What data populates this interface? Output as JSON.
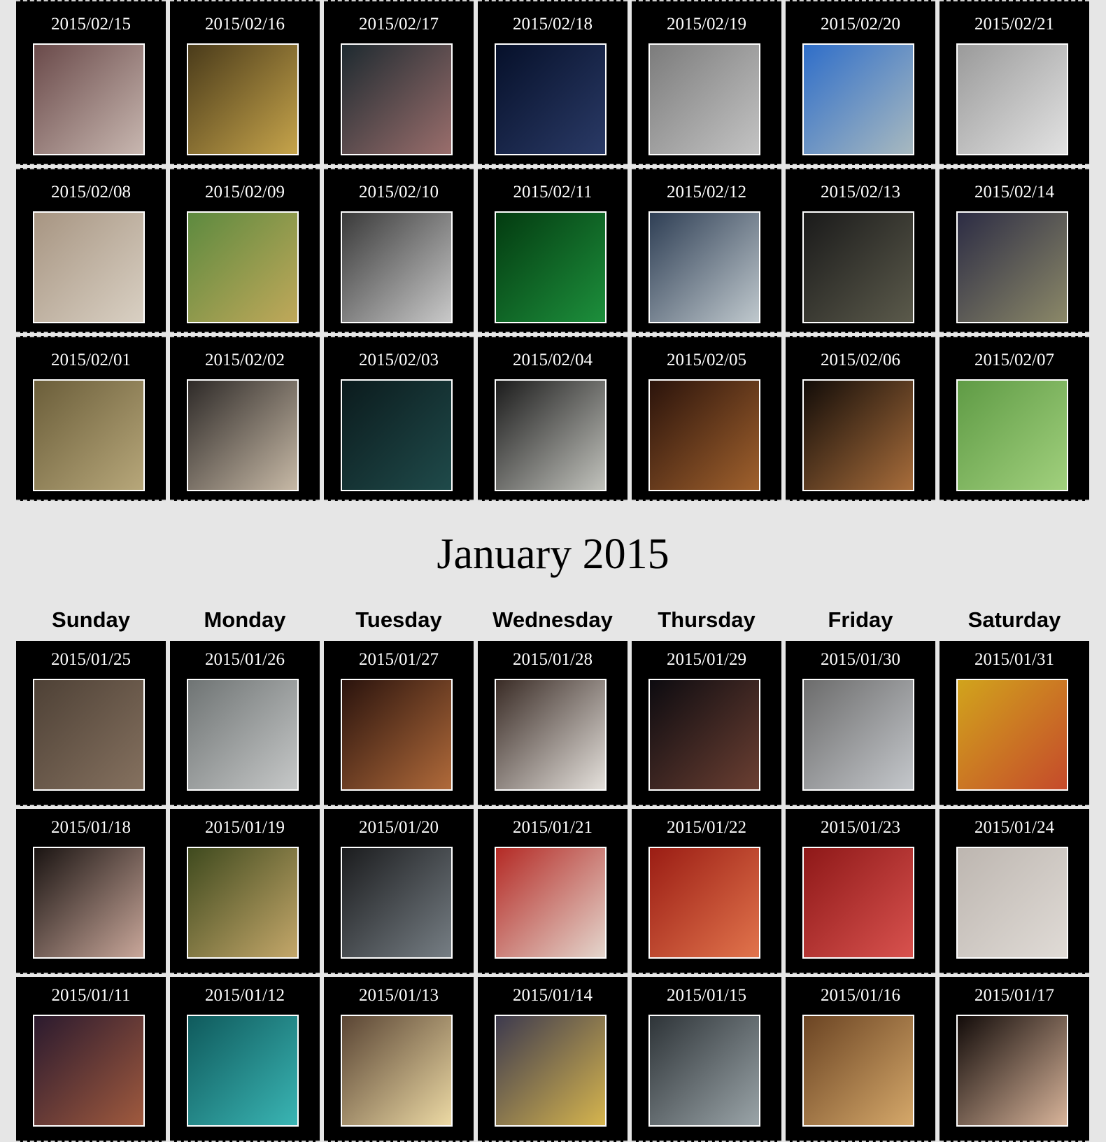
{
  "feb": {
    "weeks": [
      [
        {
          "date": "2015/02/15",
          "colors": [
            "#6a4a4a",
            "#c8b7b0"
          ]
        },
        {
          "date": "2015/02/16",
          "colors": [
            "#4a3b1a",
            "#c6a44b"
          ]
        },
        {
          "date": "2015/02/17",
          "colors": [
            "#1e2a30",
            "#9a6e6c"
          ]
        },
        {
          "date": "2015/02/18",
          "colors": [
            "#06102a",
            "#2a3a66"
          ]
        },
        {
          "date": "2015/02/19",
          "colors": [
            "#7c7c7c",
            "#c3c3c3"
          ]
        },
        {
          "date": "2015/02/20",
          "colors": [
            "#2f6ec9",
            "#a8b9bf"
          ]
        },
        {
          "date": "2015/02/21",
          "colors": [
            "#9a9a9a",
            "#e2e2e2"
          ]
        }
      ],
      [
        {
          "date": "2015/02/08",
          "colors": [
            "#a79582",
            "#d9d0c3"
          ]
        },
        {
          "date": "2015/02/09",
          "colors": [
            "#5d8a3f",
            "#c0a85a"
          ]
        },
        {
          "date": "2015/02/10",
          "colors": [
            "#3a3a3a",
            "#c9c9c9"
          ]
        },
        {
          "date": "2015/02/11",
          "colors": [
            "#033b10",
            "#1d8f3c"
          ]
        },
        {
          "date": "2015/02/12",
          "colors": [
            "#2f3f55",
            "#bfc8cd"
          ]
        },
        {
          "date": "2015/02/13",
          "colors": [
            "#1a1a1a",
            "#5b5a4b"
          ]
        },
        {
          "date": "2015/02/14",
          "colors": [
            "#2c2c44",
            "#8b8868"
          ]
        }
      ],
      [
        {
          "date": "2015/02/01",
          "colors": [
            "#6b5e3a",
            "#b7a77a"
          ]
        },
        {
          "date": "2015/02/02",
          "colors": [
            "#2e2a28",
            "#c7b9a6"
          ]
        },
        {
          "date": "2015/02/03",
          "colors": [
            "#0b1b1d",
            "#1f4a4a"
          ]
        },
        {
          "date": "2015/02/04",
          "colors": [
            "#1c1c1c",
            "#c2c3bd"
          ]
        },
        {
          "date": "2015/02/05",
          "colors": [
            "#2b130b",
            "#a0612d"
          ]
        },
        {
          "date": "2015/02/06",
          "colors": [
            "#120c08",
            "#a86d3b"
          ]
        },
        {
          "date": "2015/02/07",
          "colors": [
            "#5f9b45",
            "#a1d07d"
          ]
        }
      ]
    ]
  },
  "jan": {
    "title": "January 2015",
    "weekdays": [
      "Sunday",
      "Monday",
      "Tuesday",
      "Wednesday",
      "Thursday",
      "Friday",
      "Saturday"
    ],
    "weeks": [
      [
        {
          "date": "2015/01/25",
          "colors": [
            "#4e4136",
            "#85715f"
          ]
        },
        {
          "date": "2015/01/26",
          "colors": [
            "#6f7474",
            "#c6c8c8"
          ]
        },
        {
          "date": "2015/01/27",
          "colors": [
            "#2a130d",
            "#b06a3a"
          ]
        },
        {
          "date": "2015/01/28",
          "colors": [
            "#3a2c26",
            "#e5e1dc"
          ]
        },
        {
          "date": "2015/01/29",
          "colors": [
            "#0d0b10",
            "#6b3f32"
          ]
        },
        {
          "date": "2015/01/30",
          "colors": [
            "#6c6c6c",
            "#c4c7cb"
          ]
        },
        {
          "date": "2015/01/31",
          "colors": [
            "#d1a41c",
            "#c54a2b"
          ]
        }
      ],
      [
        {
          "date": "2015/01/18",
          "colors": [
            "#1a1412",
            "#c9a79a"
          ]
        },
        {
          "date": "2015/01/19",
          "colors": [
            "#3f4a1e",
            "#c4a76a"
          ]
        },
        {
          "date": "2015/01/20",
          "colors": [
            "#1b1c1e",
            "#767e84"
          ]
        },
        {
          "date": "2015/01/21",
          "colors": [
            "#b42a25",
            "#e4d6cd"
          ]
        },
        {
          "date": "2015/01/22",
          "colors": [
            "#9b1d14",
            "#e1744c"
          ]
        },
        {
          "date": "2015/01/23",
          "colors": [
            "#8e1818",
            "#d8524e"
          ]
        },
        {
          "date": "2015/01/24",
          "colors": [
            "#bdb6b0",
            "#e0dbd6"
          ]
        }
      ],
      [
        {
          "date": "2015/01/11",
          "colors": [
            "#2b1a2e",
            "#a05a3e"
          ]
        },
        {
          "date": "2015/01/12",
          "colors": [
            "#0f5a5c",
            "#3ab5b4"
          ]
        },
        {
          "date": "2015/01/13",
          "colors": [
            "#5a4534",
            "#ecd9a4"
          ]
        },
        {
          "date": "2015/01/14",
          "colors": [
            "#3d3a4e",
            "#d6b54e"
          ]
        },
        {
          "date": "2015/01/15",
          "colors": [
            "#2e3438",
            "#9aa4a8"
          ]
        },
        {
          "date": "2015/01/16",
          "colors": [
            "#6b4423",
            "#d5a86a"
          ]
        },
        {
          "date": "2015/01/17",
          "colors": [
            "#120b09",
            "#d8b49a"
          ]
        }
      ]
    ]
  }
}
